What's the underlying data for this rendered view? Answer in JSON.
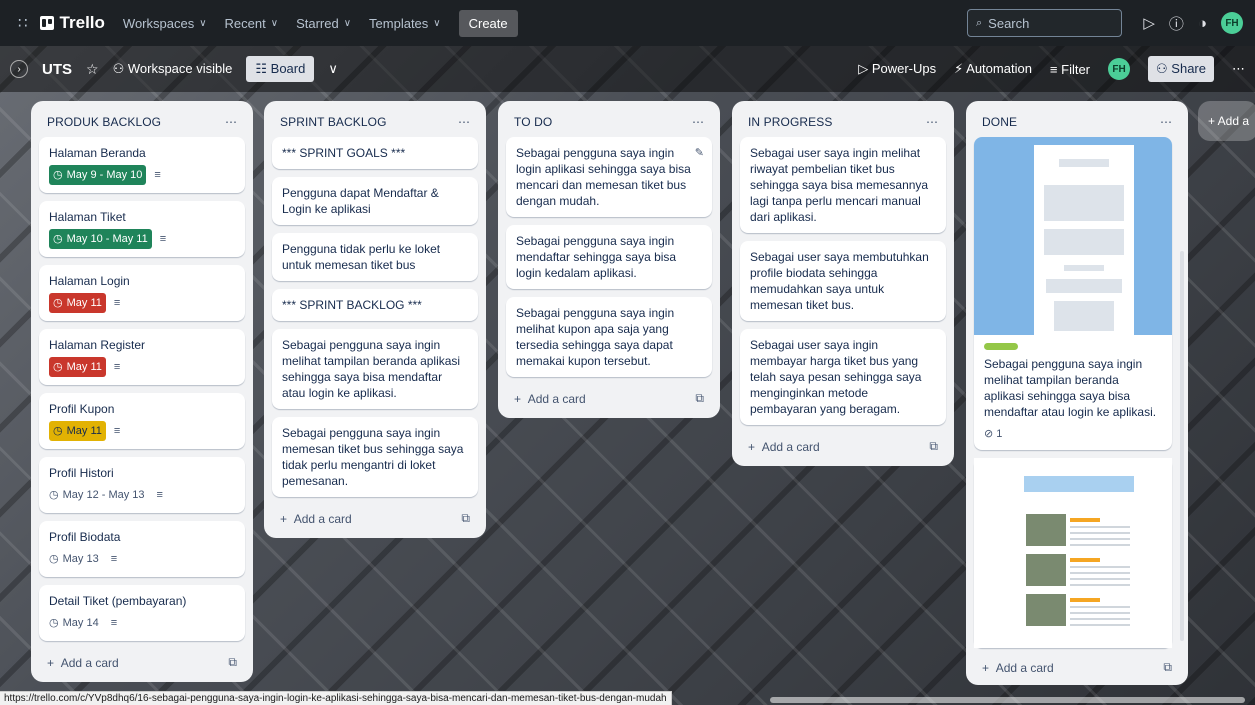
{
  "topbar": {
    "logo": "Trello",
    "menus": [
      "Workspaces",
      "Recent",
      "Starred",
      "Templates"
    ],
    "create": "Create",
    "search_placeholder": "Search",
    "avatar_initials": "FH"
  },
  "board": {
    "name": "UTS",
    "visibility": "Workspace visible",
    "view": "Board",
    "power_ups": "Power-Ups",
    "automation": "Automation",
    "filter": "Filter",
    "avatar_initials": "FH",
    "share": "Share"
  },
  "lists": [
    {
      "title": "PRODUK BACKLOG",
      "cards": [
        {
          "text": "Halaman Beranda",
          "date": "May 9 - May 10",
          "date_style": "green"
        },
        {
          "text": "Halaman Tiket",
          "date": "May 10 - May 11",
          "date_style": "green"
        },
        {
          "text": "Halaman Login",
          "date": "May 11",
          "date_style": "red"
        },
        {
          "text": "Halaman Register",
          "date": "May 11",
          "date_style": "red"
        },
        {
          "text": "Profil Kupon",
          "date": "May 11",
          "date_style": "yellow"
        },
        {
          "text": "Profil Histori",
          "date": "May 12 - May 13",
          "date_style": "plain"
        },
        {
          "text": "Profil Biodata",
          "date": "May 13",
          "date_style": "plain"
        },
        {
          "text": "Detail Tiket (pembayaran)",
          "date": "May 14",
          "date_style": "plain"
        }
      ],
      "add_card": "Add a card"
    },
    {
      "title": "SPRINT BACKLOG",
      "cards": [
        {
          "text": "*** SPRINT GOALS ***"
        },
        {
          "text": "Pengguna dapat Mendaftar & Login ke aplikasi"
        },
        {
          "text": "Pengguna tidak perlu ke loket untuk memesan tiket bus"
        },
        {
          "text": "*** SPRINT BACKLOG ***"
        },
        {
          "text": "Sebagai pengguna saya ingin melihat tampilan beranda aplikasi sehingga saya bisa mendaftar atau login ke aplikasi."
        },
        {
          "text": "Sebagai pengguna saya ingin memesan tiket bus sehingga saya tidak perlu mengantri di loket pemesanan."
        }
      ],
      "add_card": "Add a card"
    },
    {
      "title": "TO DO",
      "cards": [
        {
          "text": "Sebagai pengguna saya ingin login aplikasi sehingga saya bisa mencari dan memesan tiket bus dengan mudah."
        },
        {
          "text": "Sebagai pengguna saya ingin mendaftar sehingga saya bisa login kedalam aplikasi."
        },
        {
          "text": "Sebagai pengguna saya ingin melihat kupon apa saja yang tersedia sehingga saya dapat memakai kupon tersebut."
        }
      ],
      "add_card": "Add a card"
    },
    {
      "title": "IN PROGRESS",
      "cards": [
        {
          "text": "Sebagai user saya ingin melihat riwayat pembelian tiket bus sehingga saya bisa memesannya lagi tanpa perlu mencari manual dari aplikasi."
        },
        {
          "text": "Sebagai user saya membutuhkan profile biodata sehingga memudahkan saya untuk memesan tiket bus."
        },
        {
          "text": "Sebagai user saya ingin membayar harga tiket bus yang telah saya pesan sehingga saya menginginkan metode pembayaran yang beragam."
        }
      ],
      "add_card": "Add a card"
    },
    {
      "title": "DONE",
      "cards": [
        {
          "text": "Sebagai pengguna saya ingin melihat tampilan beranda aplikasi sehingga saya bisa mendaftar atau login ke aplikasi.",
          "attachments": "1"
        }
      ],
      "add_card": "Add a card"
    }
  ],
  "add_list": "+ Add a",
  "status_url": "https://trello.com/c/YVp8dhq6/16-sebagai-pengguna-saya-ingin-login-ke-aplikasi-sehingga-saya-bisa-mencari-dan-memesan-tiket-bus-dengan-mudah"
}
